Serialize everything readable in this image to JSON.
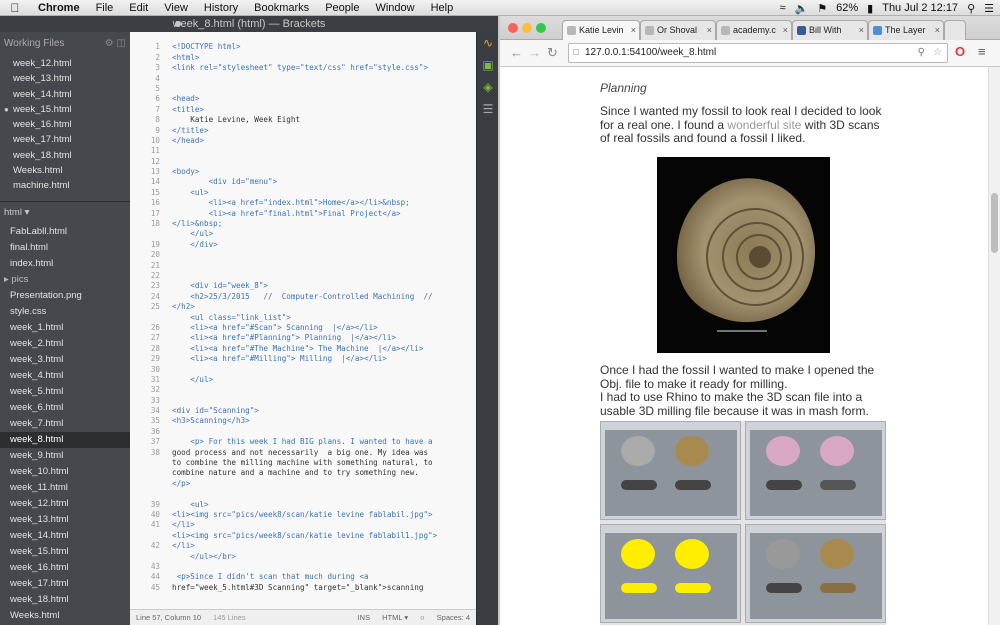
{
  "menubar": {
    "app": "Chrome",
    "items": [
      "File",
      "Edit",
      "View",
      "History",
      "Bookmarks",
      "People",
      "Window",
      "Help"
    ],
    "battery": "62%",
    "clock": "Thu Jul 2  12:17"
  },
  "brackets": {
    "title": "week_8.html (html) — Brackets",
    "working_files_label": "Working Files",
    "working_files": [
      "week_12.html",
      "week_13.html",
      "week_14.html",
      "week_15.html",
      "week_16.html",
      "week_17.html",
      "week_18.html",
      "Weeks.html",
      "machine.html"
    ],
    "project_label": "html",
    "tree": [
      {
        "label": "FabLabll.html",
        "type": "file"
      },
      {
        "label": "final.html",
        "type": "file"
      },
      {
        "label": "index.html",
        "type": "file"
      },
      {
        "label": "pics",
        "type": "folder"
      },
      {
        "label": "Presentation.png",
        "type": "file"
      },
      {
        "label": "style.css",
        "type": "file"
      },
      {
        "label": "week_1.html",
        "type": "file"
      },
      {
        "label": "week_2.html",
        "type": "file"
      },
      {
        "label": "week_3.html",
        "type": "file"
      },
      {
        "label": "week_4.html",
        "type": "file"
      },
      {
        "label": "week_5.html",
        "type": "file"
      },
      {
        "label": "week_6.html",
        "type": "file"
      },
      {
        "label": "week_7.html",
        "type": "file"
      },
      {
        "label": "week_8.html",
        "type": "file",
        "selected": true
      },
      {
        "label": "week_9.html",
        "type": "file"
      },
      {
        "label": "week_10.html",
        "type": "file"
      },
      {
        "label": "week_11.html",
        "type": "file"
      },
      {
        "label": "week_12.html",
        "type": "file"
      },
      {
        "label": "week_13.html",
        "type": "file"
      },
      {
        "label": "week_14.html",
        "type": "file"
      },
      {
        "label": "week_15.html",
        "type": "file"
      },
      {
        "label": "week_16.html",
        "type": "file"
      },
      {
        "label": "week_17.html",
        "type": "file"
      },
      {
        "label": "week_18.html",
        "type": "file"
      },
      {
        "label": "Weeks.html",
        "type": "file"
      }
    ],
    "gutter": [
      "",
      "1",
      "2",
      "3",
      "4",
      "5",
      "6",
      "7",
      "8",
      "9",
      "10",
      "11",
      "12",
      "13",
      "14",
      "15",
      "16",
      "17",
      "18",
      "",
      "19",
      "20",
      "21",
      "22",
      "23",
      "24",
      "25",
      "",
      "26",
      "27",
      "28",
      "29",
      "30",
      "31",
      "32",
      "33",
      "34",
      "35",
      "36",
      "37",
      "38",
      "",
      "",
      "",
      "",
      "39",
      "40",
      "41",
      "",
      "42",
      "",
      "43",
      "44",
      "45",
      ""
    ],
    "code_lines": [
      "",
      "<!DOCTYPE html>",
      "<html>",
      "<link rel=\"stylesheet\" type=\"text/css\" href=\"style.css\">",
      "",
      "",
      "<head>",
      "<title>",
      "    Katie Levine, Week Eight",
      "</title>",
      "</head>",
      "",
      "",
      "<body>",
      "        <div id=\"menu\">",
      "    <ul>",
      "        <li><a href=\"index.html\">Home</a></li>&nbsp;",
      "        <li><a href=\"final.html\">Final Project</a>",
      "</li>&nbsp;",
      "    </ul>",
      "    </div>",
      "",
      "",
      "",
      "    <div id=\"week_8\">",
      "    <h2>25/3/2015   //  Computer-Controlled Machining  //",
      "</h2>",
      "    <ul class=\"link_list\">",
      "    <li><a href=\"#Scan\"> Scanning  |</a></li>",
      "    <li><a href=\"#Planning\"> Planning  |</a></li>",
      "    <li><a href=\"#The Machine\"> The Machine  |</a></li>",
      "    <li><a href=\"#Milling\"> Milling  |</a></li>",
      "",
      "    </ul>",
      "",
      "",
      "<div id=\"Scanning\">",
      "<h3>Scanning</h3>",
      "",
      "    <p> For this week I had BIG plans. I wanted to have a",
      "good process and not necessarily  a big one. My idea was",
      "to combine the milling machine with something natural, to",
      "combine nature and a machine and to try something new.",
      "</p>",
      "",
      "    <ul>",
      "<li><img src=\"pics/week8/scan/katie levine fablabil.jpg\">",
      "</li>",
      "<li><img src=\"pics/week8/scan/katie levine fablabil1.jpg\">",
      "</li>",
      "    </ul></br>",
      "",
      " <p>Since I didn't scan that much during <a",
      "href=\"week_5.html#3D Scanning\" target=\"_blank\">scanning"
    ],
    "status": {
      "position": "Line 57, Column 10",
      "lines": "145 Lines",
      "mode": "INS",
      "lang": "HTML",
      "spaces": "Spaces: 4"
    }
  },
  "chrome": {
    "tabs": [
      {
        "label": "Katie Levin",
        "active": true
      },
      {
        "label": "Or Shoval",
        "active": false
      },
      {
        "label": "academy.c",
        "active": false
      },
      {
        "label": "Bill With",
        "active": false
      },
      {
        "label": "The Layer",
        "active": false
      }
    ],
    "url": "127.0.0.1:54100/week_8.html",
    "page": {
      "heading": "Planning",
      "p1_before": "Since I wanted my fossil to look real I decided to look for a real one. I found a ",
      "p1_link": "wonderful site",
      "p1_after": " with 3D scans of real fossils and found a fossil I liked.",
      "p2": "Once I had the fossil I wanted to make I opened the Obj. file to make it ready for milling.",
      "p3": "I had to use Rhino to make the 3D scan file into a usable 3D milling file because it was in mash form."
    }
  }
}
